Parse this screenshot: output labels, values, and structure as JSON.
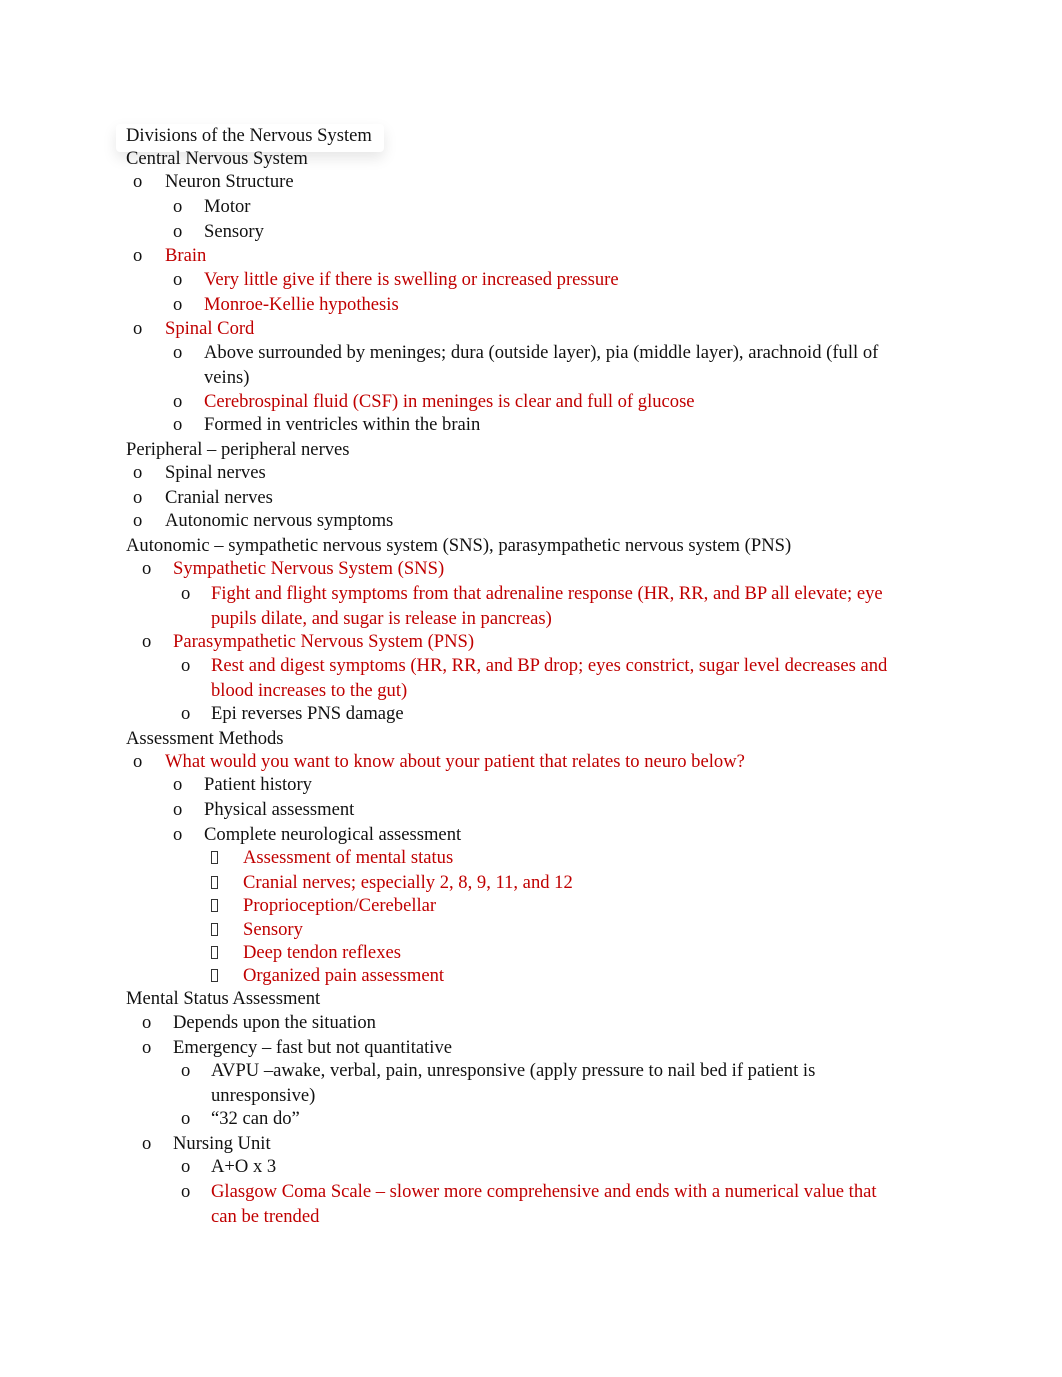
{
  "document": {
    "title": "Divisions of the Nervous System",
    "lines": [
      {
        "level": 0,
        "text": "Central Nervous System",
        "color": "black"
      },
      {
        "level": 1,
        "text": "Neuron Structure",
        "color": "black",
        "bullet": "o"
      },
      {
        "level": 2,
        "text": "Motor",
        "color": "black",
        "bullet": "o"
      },
      {
        "level": 2,
        "text": "Sensory",
        "color": "black",
        "bullet": "o"
      },
      {
        "level": 1,
        "text": "Brain",
        "color": "red",
        "bullet": "o"
      },
      {
        "level": 2,
        "text": "Very little give if there is swelling or increased pressure",
        "color": "red",
        "bullet": "o"
      },
      {
        "level": 2,
        "text": "Monroe-Kellie hypothesis",
        "color": "red",
        "bullet": "o"
      },
      {
        "level": 1,
        "text": "Spinal Cord",
        "color": "red",
        "bullet": "o"
      },
      {
        "level": 2,
        "text": "Above surrounded by meninges; dura (outside layer), pia (middle layer), arachnoid (full of",
        "color": "black",
        "bullet": "o"
      },
      {
        "level": 2,
        "text": "veins)",
        "color": "black",
        "continuation": true
      },
      {
        "level": 2,
        "text": "Cerebrospinal fluid (CSF) in meninges is clear and full of glucose",
        "color": "red",
        "bullet": "o"
      },
      {
        "level": 2,
        "text": "Formed in ventricles within the brain",
        "color": "black",
        "bullet": "o"
      },
      {
        "level": 0,
        "text": "Peripheral –  peripheral nerves",
        "color": "black"
      },
      {
        "level": 1,
        "text": "Spinal nerves",
        "color": "black",
        "bullet": "o"
      },
      {
        "level": 1,
        "text": "Cranial nerves",
        "color": "black",
        "bullet": "o"
      },
      {
        "level": 1,
        "text": "Autonomic nervous symptoms",
        "color": "black",
        "bullet": "o"
      },
      {
        "level": 0,
        "text": "Autonomic – sympathetic nervous system (SNS), parasympathetic nervous system (PNS)",
        "color": "black"
      },
      {
        "level": "1b",
        "text": "Sympathetic Nervous System (SNS)",
        "color": "red",
        "bullet": "o"
      },
      {
        "level": "2b",
        "text": "Fight and flight symptoms from that adrenaline response (HR, RR, and BP all elevate; eye",
        "color": "red",
        "bullet": "o"
      },
      {
        "level": "2b",
        "text": "pupils dilate, and sugar is release in pancreas)",
        "color": "red",
        "continuation": true
      },
      {
        "level": "1b",
        "text": "Parasympathetic Nervous System (PNS)",
        "color": "red",
        "bullet": "o"
      },
      {
        "level": "2b",
        "text": "Rest and digest symptoms (HR, RR, and BP drop; eyes constrict, sugar level decreases and",
        "color": "red",
        "bullet": "o"
      },
      {
        "level": "2b",
        "text": "blood increases to the gut)",
        "color": "red",
        "continuation": true
      },
      {
        "level": "2b",
        "text": "Epi reverses PNS damage",
        "color": "black",
        "bullet": "o"
      },
      {
        "level": 0,
        "text": "Assessment Methods",
        "color": "black"
      },
      {
        "level": 1,
        "text": "What would you want to know about your patient that relates to neuro below?",
        "color": "red",
        "bullet": "o"
      },
      {
        "level": 2,
        "text": "Patient history",
        "color": "black",
        "bullet": "o"
      },
      {
        "level": 2,
        "text": "Physical assessment",
        "color": "black",
        "bullet": "o"
      },
      {
        "level": 2,
        "text": "Complete neurological assessment",
        "color": "black",
        "bullet": "o"
      },
      {
        "level": 3,
        "text": "Assessment of mental status",
        "color": "red",
        "bullet": "box"
      },
      {
        "level": 3,
        "text": "Cranial nerves; especially 2, 8, 9, 11, and 12",
        "color": "red",
        "bullet": "box"
      },
      {
        "level": 3,
        "text": "Proprioception/Cerebellar",
        "color": "red",
        "bullet": "box"
      },
      {
        "level": 3,
        "text": "Sensory",
        "color": "red",
        "bullet": "box"
      },
      {
        "level": 3,
        "text": "Deep tendon reflexes",
        "color": "red",
        "bullet": "box"
      },
      {
        "level": 3,
        "text": "Organized pain assessment",
        "color": "red",
        "bullet": "box"
      },
      {
        "level": 0,
        "text": "Mental Status Assessment",
        "color": "black"
      },
      {
        "level": "1b",
        "text": "Depends upon the situation",
        "color": "black",
        "bullet": "o"
      },
      {
        "level": "1b",
        "text": "Emergency – fast but not quantitative",
        "color": "black",
        "bullet": "o"
      },
      {
        "level": "2b",
        "text": "AVPU –awake, verbal, pain, unresponsive (apply pressure to nail bed if patient is",
        "color": "black",
        "bullet": "o"
      },
      {
        "level": "2b",
        "text": "unresponsive)",
        "color": "black",
        "continuation": true
      },
      {
        "level": "2b",
        "text": "“32 can do”",
        "color": "black",
        "bullet": "o"
      },
      {
        "level": "1b",
        "text": "Nursing Unit",
        "color": "black",
        "bullet": "o"
      },
      {
        "level": "2b",
        "text": "A+O x 3",
        "color": "black",
        "bullet": "o"
      },
      {
        "level": "2b",
        "text": "Glasgow Coma Scale – slower more comprehensive and ends with a numerical value that",
        "color": "red",
        "bullet": "o"
      },
      {
        "level": "2b",
        "text": "can be trended",
        "color": "red",
        "continuation": true
      }
    ]
  },
  "colors": {
    "text": "#111111",
    "highlight_red": "#C00000"
  }
}
